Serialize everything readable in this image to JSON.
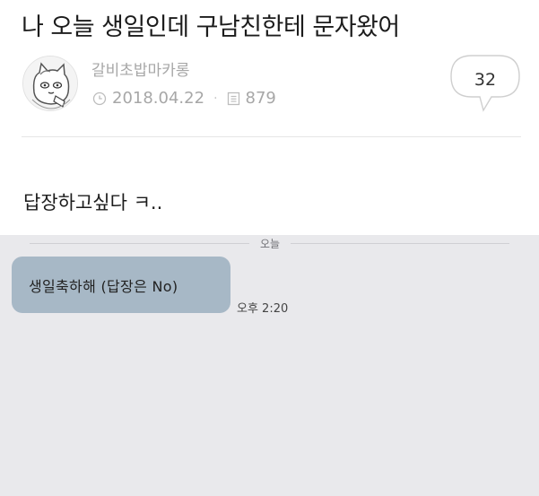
{
  "post": {
    "title": "나 오늘 생일인데 구남친한테 문자왔어",
    "author": "갈비초밥마카롱",
    "date": "2018.04.22",
    "views": "879",
    "comment_count": "32",
    "body": "답장하고싶다 ㅋ..",
    "icons": {
      "date": "clock-icon",
      "views": "document-icon",
      "comments": "speech-bubble-icon",
      "avatar": "cat-avatar"
    }
  },
  "chat": {
    "date_separator": "오늘",
    "message": "생일축하해 (답장은 No)",
    "time": "오후 2:20",
    "colors": {
      "background": "#e9e9ec",
      "bubble": "#a7b8c6"
    }
  }
}
